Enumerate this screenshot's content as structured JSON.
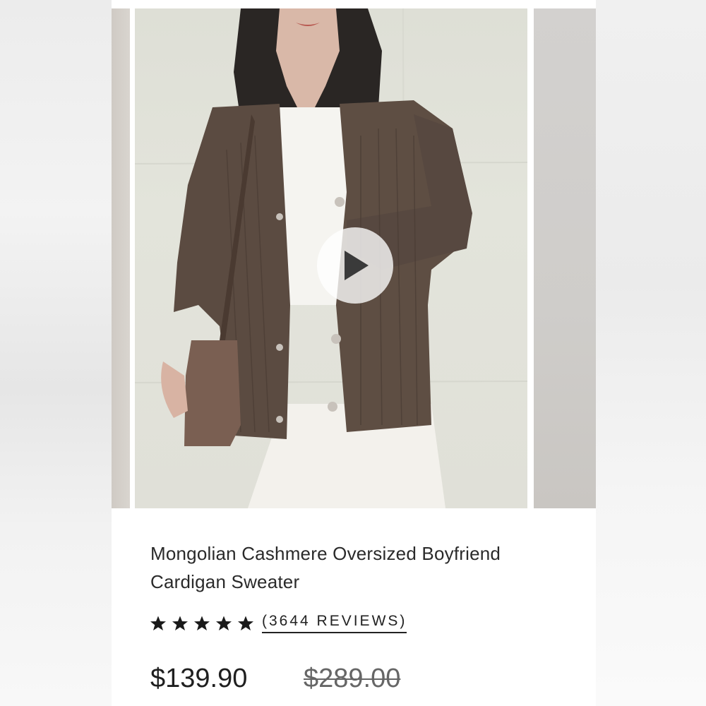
{
  "product": {
    "title": "Mongolian Cashmere Oversized Boyfriend Cardigan Sweater",
    "rating_stars": 5,
    "reviews_label": "(3644 REVIEWS)",
    "price_current": "$139.90",
    "price_original": "$289.00"
  },
  "media": {
    "play_icon": "play-icon",
    "slide_main": "product-image"
  },
  "colors": {
    "text": "#2a2a2a",
    "star": "#1a1a1a",
    "cardigan": "#5a4a40"
  }
}
